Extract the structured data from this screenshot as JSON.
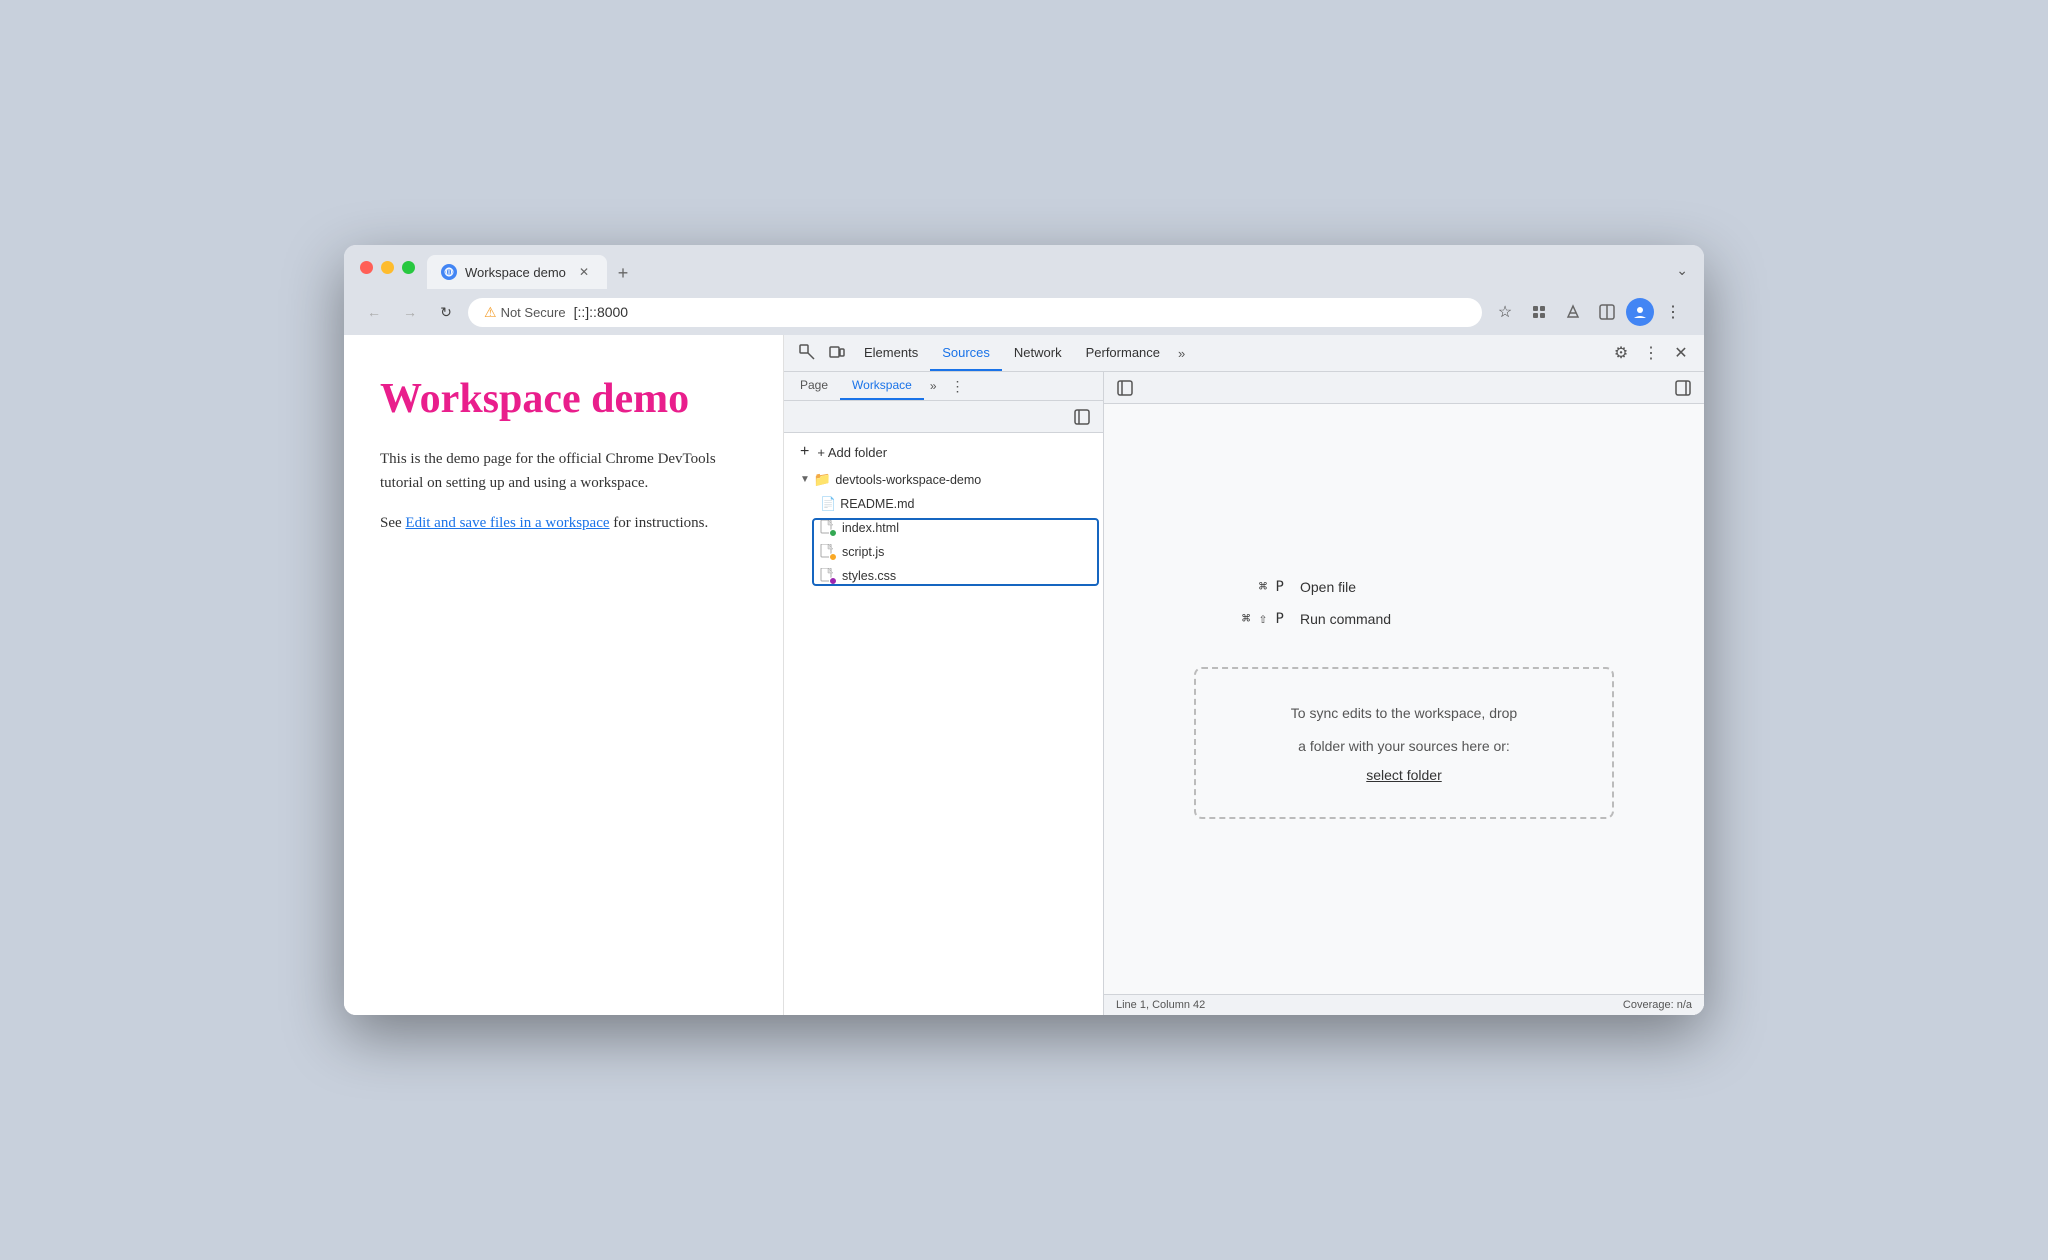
{
  "browser": {
    "tab": {
      "title": "Workspace demo",
      "favicon_label": "globe-icon"
    },
    "address": {
      "security_text": "Not Secure",
      "url": "[::]::8000"
    },
    "toolbar": {
      "back": "←",
      "forward": "→",
      "reload": "↻",
      "bookmark": "☆",
      "extensions": "⬡",
      "dropper": "⊕",
      "split": "⊡",
      "profile": "👤",
      "more": "⋮"
    }
  },
  "webpage": {
    "title": "Workspace demo",
    "body": "This is the demo page for the official Chrome DevTools tutorial on setting up and using a workspace.",
    "link_prefix": "See ",
    "link_text": "Edit and save files in a workspace",
    "link_suffix": " for instructions."
  },
  "devtools": {
    "tabs": [
      {
        "label": "Elements",
        "active": false
      },
      {
        "label": "Sources",
        "active": true
      },
      {
        "label": "Network",
        "active": false
      },
      {
        "label": "Performance",
        "active": false
      }
    ],
    "overflow": "»",
    "sources": {
      "sidebar_tabs": [
        {
          "label": "Page",
          "active": false
        },
        {
          "label": "Workspace",
          "active": true
        }
      ],
      "add_folder": "+ Add folder",
      "folder_name": "devtools-workspace-demo",
      "files": [
        {
          "name": "README.md",
          "type": "md",
          "dot": null
        },
        {
          "name": "index.html",
          "type": "html",
          "dot": "green"
        },
        {
          "name": "script.js",
          "type": "js",
          "dot": "orange"
        },
        {
          "name": "styles.css",
          "type": "css",
          "dot": "purple"
        }
      ],
      "shortcuts": [
        {
          "keys": "⌘ P",
          "label": "Open file"
        },
        {
          "keys": "⌘ ⇧ P",
          "label": "Run command"
        }
      ],
      "drop_text_1": "To sync edits to the workspace, drop",
      "drop_text_2": "a folder with your sources here or:",
      "select_folder": "select folder"
    },
    "statusbar": {
      "position": "Line 1, Column 42",
      "coverage": "Coverage: n/a"
    }
  }
}
